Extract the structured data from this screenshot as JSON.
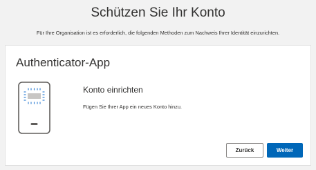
{
  "header": {
    "title": "Schützen Sie Ihr Konto",
    "subtitle": "Für Ihre Organisation ist es erforderlich, die folgenden Methoden zum Nachweis Ihrer Identität einzurichten."
  },
  "card": {
    "title": "Authenticator-App",
    "illustration_icon": "phone-qr-scan-icon",
    "step_heading": "Konto einrichten",
    "step_description": "Fügen Sie Ihrer App ein neues Konto hinzu."
  },
  "buttons": {
    "back_label": "Zurück",
    "next_label": "Weiter"
  },
  "colors": {
    "accent": "#0067b8",
    "illustration_stroke": "#605e5c",
    "scan_dots": "#3b86d6"
  }
}
